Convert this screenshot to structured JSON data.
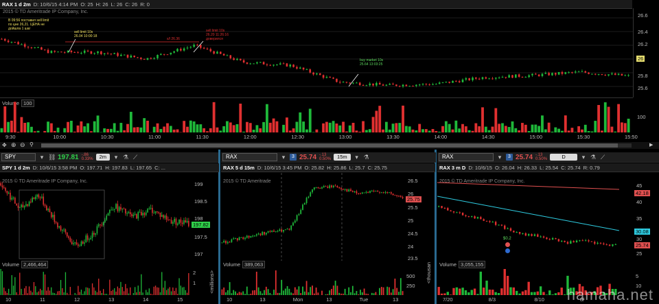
{
  "top": {
    "header": {
      "symbol": "RAX 1 d 2m",
      "date": "D: 10/6/15 4:14 PM",
      "open": "O: 25",
      "high": "H: 26",
      "low": "L: 26",
      "close": "C: 26",
      "range": "R: 0"
    },
    "copyright": "2015 © TD Ameritrade IP Company, Inc.",
    "watermark": "HOSTING",
    "yticks": [
      "26.6",
      "26.4",
      "26.2",
      "26",
      "25.8",
      "25.6"
    ],
    "price_tag": "26",
    "vol_label": "Volume",
    "vol_value": "100",
    "vol_tick": "100",
    "xticks": [
      "9:30",
      "10:00",
      "10:30",
      "11:00",
      "11:30",
      "12:00",
      "12:30",
      "13:00",
      "13:30",
      "14:00",
      "14:30",
      "15:00",
      "15:30",
      "15:50"
    ],
    "notes": {
      "n1": [
        "В 09:56 поставил sell limit",
        "по цне 26,21. ЦЕНА не",
        "дойшла 1 шаг"
      ],
      "n2": [
        "sell limit 10s",
        "26.04 10:00:18"
      ],
      "n3": "s/l 26.36",
      "n4": [
        "sell limit 10s",
        "26.20 11:26:16",
        "доверился"
      ],
      "n5": [
        "buy market 10s",
        "25.64 13:03:25"
      ]
    }
  },
  "panes": [
    {
      "sym_box": "SPY",
      "last": "197.81",
      "last_color": "#2fd04a",
      "chg1": "-.86",
      "chg2": "0.33%",
      "tf": "2m",
      "header": [
        "SPY 1 d 2m",
        "D: 10/6/15 3:58 PM",
        "O: 197.71",
        "H: 197.83",
        "L: 197.65",
        "C: ..."
      ],
      "copyright": "2015 © TD Ameritrade IP Company, Inc.",
      "watermark": "SPDRs",
      "yticks": [
        "199",
        "198.5",
        "198",
        "197.5",
        "197"
      ],
      "tag": "197.82",
      "tag_color": "#2fd04a",
      "vol_label": "Volume",
      "vol_value": "2,466,464",
      "vol_unit": "<millions>",
      "vol_ticks": [
        "2",
        "1"
      ],
      "xticks": [
        "10",
        "11",
        "12",
        "13",
        "14",
        "15"
      ]
    },
    {
      "sym_box": "RAX",
      "last": "25.74",
      "last_color": "#e05050",
      "chg1": "-.13",
      "chg2": "0.50%",
      "tf": "15m",
      "header": [
        "RAX 5 d 15m",
        "D: 10/6/15 3:45 PM",
        "O: 25.82",
        "H: 25.86",
        "L: 25.7",
        "C: 25.75"
      ],
      "copyright": "2015 © TD Ameritrade",
      "watermark": "HOSTING",
      "yticks": [
        "26.5",
        "26",
        "25.5",
        "25",
        "24.5",
        "24",
        "23.5"
      ],
      "tag": "25.75",
      "tag_color": "#e05050",
      "vol_label": "Volume",
      "vol_value": "389,063",
      "vol_unit": "<thousan",
      "vol_ticks": [
        "500",
        "250"
      ],
      "xticks": [
        "10",
        "13",
        "Mon",
        "13",
        "Tue",
        "13"
      ]
    },
    {
      "sym_box": "RAX",
      "last": "25.74",
      "last_color": "#e05050",
      "chg1": "-.13",
      "chg2": "0.50%",
      "tf": "D",
      "header": [
        "RAX 3 m D",
        "D: 10/6/15",
        "O: 26.04",
        "H: 26.33",
        "L: 25.54",
        "C: 25.74",
        "R: 0.79"
      ],
      "copyright": "2015 © TD Ameritrade IP Company, Inc.",
      "watermark": "HOSTING",
      "yticks": [
        "45",
        "40",
        "35",
        "30",
        "25"
      ],
      "tags": [
        {
          "t": "42.18",
          "c": "#e05050"
        },
        {
          "t": "30.08",
          "c": "#2ecbe0"
        },
        {
          "t": "25.74",
          "c": "#e05050"
        }
      ],
      "vol_label": "Volume",
      "vol_value": "3,055,155",
      "vol_ticks": [
        "5",
        "10"
      ],
      "xticks": [
        "7/20",
        "8/3",
        "8/10",
        "8/"
      ],
      "event": "$0.2"
    }
  ],
  "watermark_site": "hamaha.net",
  "colors": {
    "up": "#1fb83a",
    "down": "#e03030",
    "bg": "#000000",
    "grid": "#333333"
  },
  "chart_data": [
    {
      "type": "candlestick",
      "title": "RAX 1 d 2m",
      "ylim": [
        25.5,
        26.7
      ],
      "x": [
        "9:30",
        "10:00",
        "10:30",
        "11:00",
        "11:30",
        "12:00",
        "12:30",
        "13:00",
        "13:30",
        "14:00",
        "14:30",
        "15:00",
        "15:30",
        "15:50"
      ],
      "close_approx": [
        26.3,
        26.1,
        26.1,
        26.0,
        26.2,
        25.95,
        25.9,
        25.65,
        25.6,
        25.62,
        25.72,
        25.75,
        25.8,
        25.74
      ]
    },
    {
      "type": "line",
      "title": "SPY 1 d 2m",
      "ylim": [
        196.9,
        199.1
      ],
      "x": [
        "10",
        "11",
        "12",
        "13",
        "14",
        "15"
      ],
      "y": [
        198.6,
        198.1,
        197.6,
        197.4,
        198.0,
        197.82
      ]
    },
    {
      "type": "candlestick",
      "title": "RAX 5 d 15m",
      "ylim": [
        23.4,
        26.6
      ],
      "x": [
        "10",
        "13",
        "Mon",
        "13",
        "Tue",
        "13"
      ],
      "y": [
        24.0,
        24.3,
        24.5,
        26.1,
        25.9,
        25.75
      ]
    },
    {
      "type": "candlestick",
      "title": "RAX 3 m D",
      "ylim": [
        22,
        46
      ],
      "x": [
        "7/20",
        "8/3",
        "8/10",
        "8/"
      ],
      "y": [
        36,
        34,
        30,
        27,
        25.74
      ],
      "series": [
        {
          "name": "42.18"
        },
        {
          "name": "30.08"
        }
      ]
    }
  ]
}
